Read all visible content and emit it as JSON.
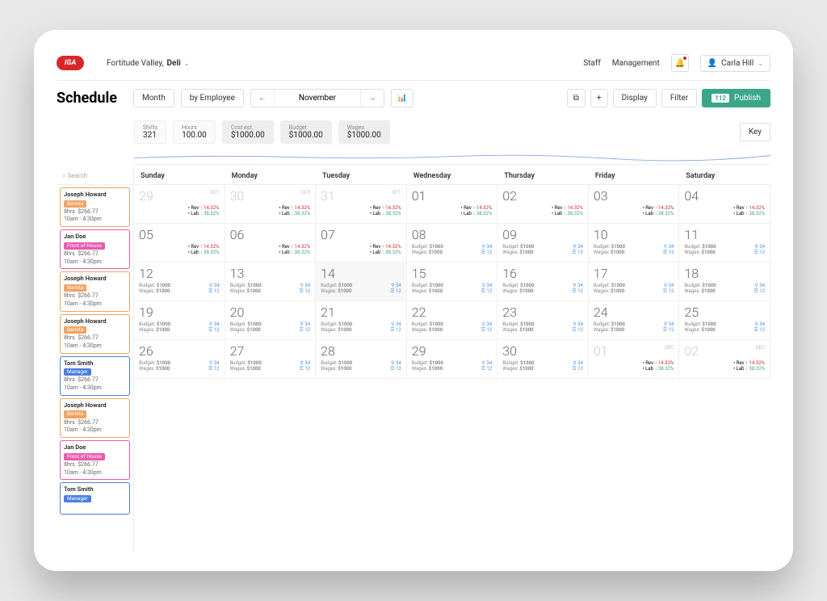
{
  "brand": "IGA",
  "location": {
    "store": "Fortitude Valley,",
    "area": "Deli"
  },
  "nav": {
    "staff": "Staff",
    "management": "Management",
    "user": "Carla Hill"
  },
  "title": "Schedule",
  "toolbar": {
    "view": "Month",
    "group": "by Employee",
    "period": "November",
    "display": "Display",
    "filter": "Filter",
    "publish": "Publish",
    "publish_count": "112",
    "key": "Key"
  },
  "stats": {
    "shifts_lbl": "Shifts",
    "shifts_val": "321",
    "hours_lbl": "Hours",
    "hours_val": "100.00",
    "cost_lbl": "Cost est.",
    "cost_val": "$1000.00",
    "budget_lbl": "Budget",
    "budget_val": "$1000.00",
    "wages_lbl": "Wages",
    "wages_val": "$1000.00"
  },
  "search_placeholder": "Search",
  "shifts": [
    {
      "name": "Joseph Howard",
      "role": "Barista",
      "cls": "barista",
      "hrs": "8hrs",
      "amt": "$266.77",
      "time": "10am - 4:30pm"
    },
    {
      "name": "Jan Doe",
      "role": "Front of House",
      "cls": "foh",
      "hrs": "8hrs",
      "amt": "$266.77",
      "time": "10am - 4:30pm"
    },
    {
      "name": "Joseph Howard",
      "role": "Barista",
      "cls": "barista",
      "hrs": "8hrs",
      "amt": "$266.77",
      "time": "10am - 4:30pm"
    },
    {
      "name": "Joseph Howard",
      "role": "Barista",
      "cls": "barista",
      "hrs": "8hrs",
      "amt": "$266.77",
      "time": "10am - 4:30pm"
    },
    {
      "name": "Tom Smith",
      "role": "Manager",
      "cls": "manager",
      "hrs": "8hrs",
      "amt": "$266.77",
      "time": "10am - 4:30pm"
    },
    {
      "name": "Joseph Howard",
      "role": "Barista",
      "cls": "barista",
      "hrs": "8hrs",
      "amt": "$266.77",
      "time": "10am - 4:30pm"
    },
    {
      "name": "Jan Doe",
      "role": "Front of House",
      "cls": "foh",
      "hrs": "8hrs",
      "amt": "$266.77",
      "time": "10am - 4:30pm"
    },
    {
      "name": "Tom Smith",
      "role": "Manager",
      "cls": "manager",
      "hrs": "",
      "amt": "",
      "time": ""
    }
  ],
  "dow": [
    "Sunday",
    "Monday",
    "Tuesday",
    "Wednesday",
    "Thursday",
    "Friday",
    "Saturday"
  ],
  "weeks": [
    [
      {
        "n": "29",
        "tag": "OCT",
        "in": false,
        "pct": true
      },
      {
        "n": "30",
        "tag": "OCT",
        "in": false,
        "pct": true
      },
      {
        "n": "31",
        "tag": "OCT",
        "in": false,
        "pct": true
      },
      {
        "n": "01",
        "in": true,
        "pct": true
      },
      {
        "n": "02",
        "in": true,
        "pct": true
      },
      {
        "n": "03",
        "in": true,
        "pct": true
      },
      {
        "n": "04",
        "in": true,
        "pct": true
      }
    ],
    [
      {
        "n": "05",
        "in": true,
        "pct": true
      },
      {
        "n": "06",
        "in": true,
        "pct": true
      },
      {
        "n": "07",
        "in": true,
        "pct": true
      },
      {
        "n": "08",
        "in": true,
        "bw": true,
        "selected": true
      },
      {
        "n": "09",
        "in": true,
        "bw": true
      },
      {
        "n": "10",
        "in": true,
        "bw": true
      },
      {
        "n": "11",
        "in": true,
        "bw": true
      }
    ],
    [
      {
        "n": "12",
        "in": true,
        "bw": true
      },
      {
        "n": "13",
        "in": true,
        "bw": true
      },
      {
        "n": "14",
        "in": true,
        "bw": true,
        "today": true
      },
      {
        "n": "15",
        "in": true,
        "bw": true
      },
      {
        "n": "16",
        "in": true,
        "bw": true
      },
      {
        "n": "17",
        "in": true,
        "bw": true
      },
      {
        "n": "18",
        "in": true,
        "bw": true
      }
    ],
    [
      {
        "n": "19",
        "in": true,
        "bw": true
      },
      {
        "n": "20",
        "in": true,
        "bw": true
      },
      {
        "n": "21",
        "in": true,
        "bw": true
      },
      {
        "n": "22",
        "in": true,
        "bw": true
      },
      {
        "n": "23",
        "in": true,
        "bw": true
      },
      {
        "n": "24",
        "in": true,
        "bw": true
      },
      {
        "n": "25",
        "in": true,
        "bw": true
      }
    ],
    [
      {
        "n": "26",
        "in": true,
        "bw": true
      },
      {
        "n": "27",
        "in": true,
        "bw": true
      },
      {
        "n": "28",
        "in": true,
        "bw": true
      },
      {
        "n": "29",
        "in": true,
        "bw": true
      },
      {
        "n": "30",
        "in": true,
        "bw": true
      },
      {
        "n": "01",
        "tag": "DEC",
        "in": false,
        "pct": true
      },
      {
        "n": "02",
        "tag": "DEC",
        "in": false,
        "pct": true
      }
    ]
  ],
  "cell_labels": {
    "budget": "Budget",
    "wages": "Wages",
    "budget_val": "$1000",
    "wages_val": "$1000",
    "a": "34",
    "b": "12",
    "rev": "Rev",
    "lab": "Lab",
    "rev_pct": "14.32%",
    "lab_pct": "38.32%"
  }
}
